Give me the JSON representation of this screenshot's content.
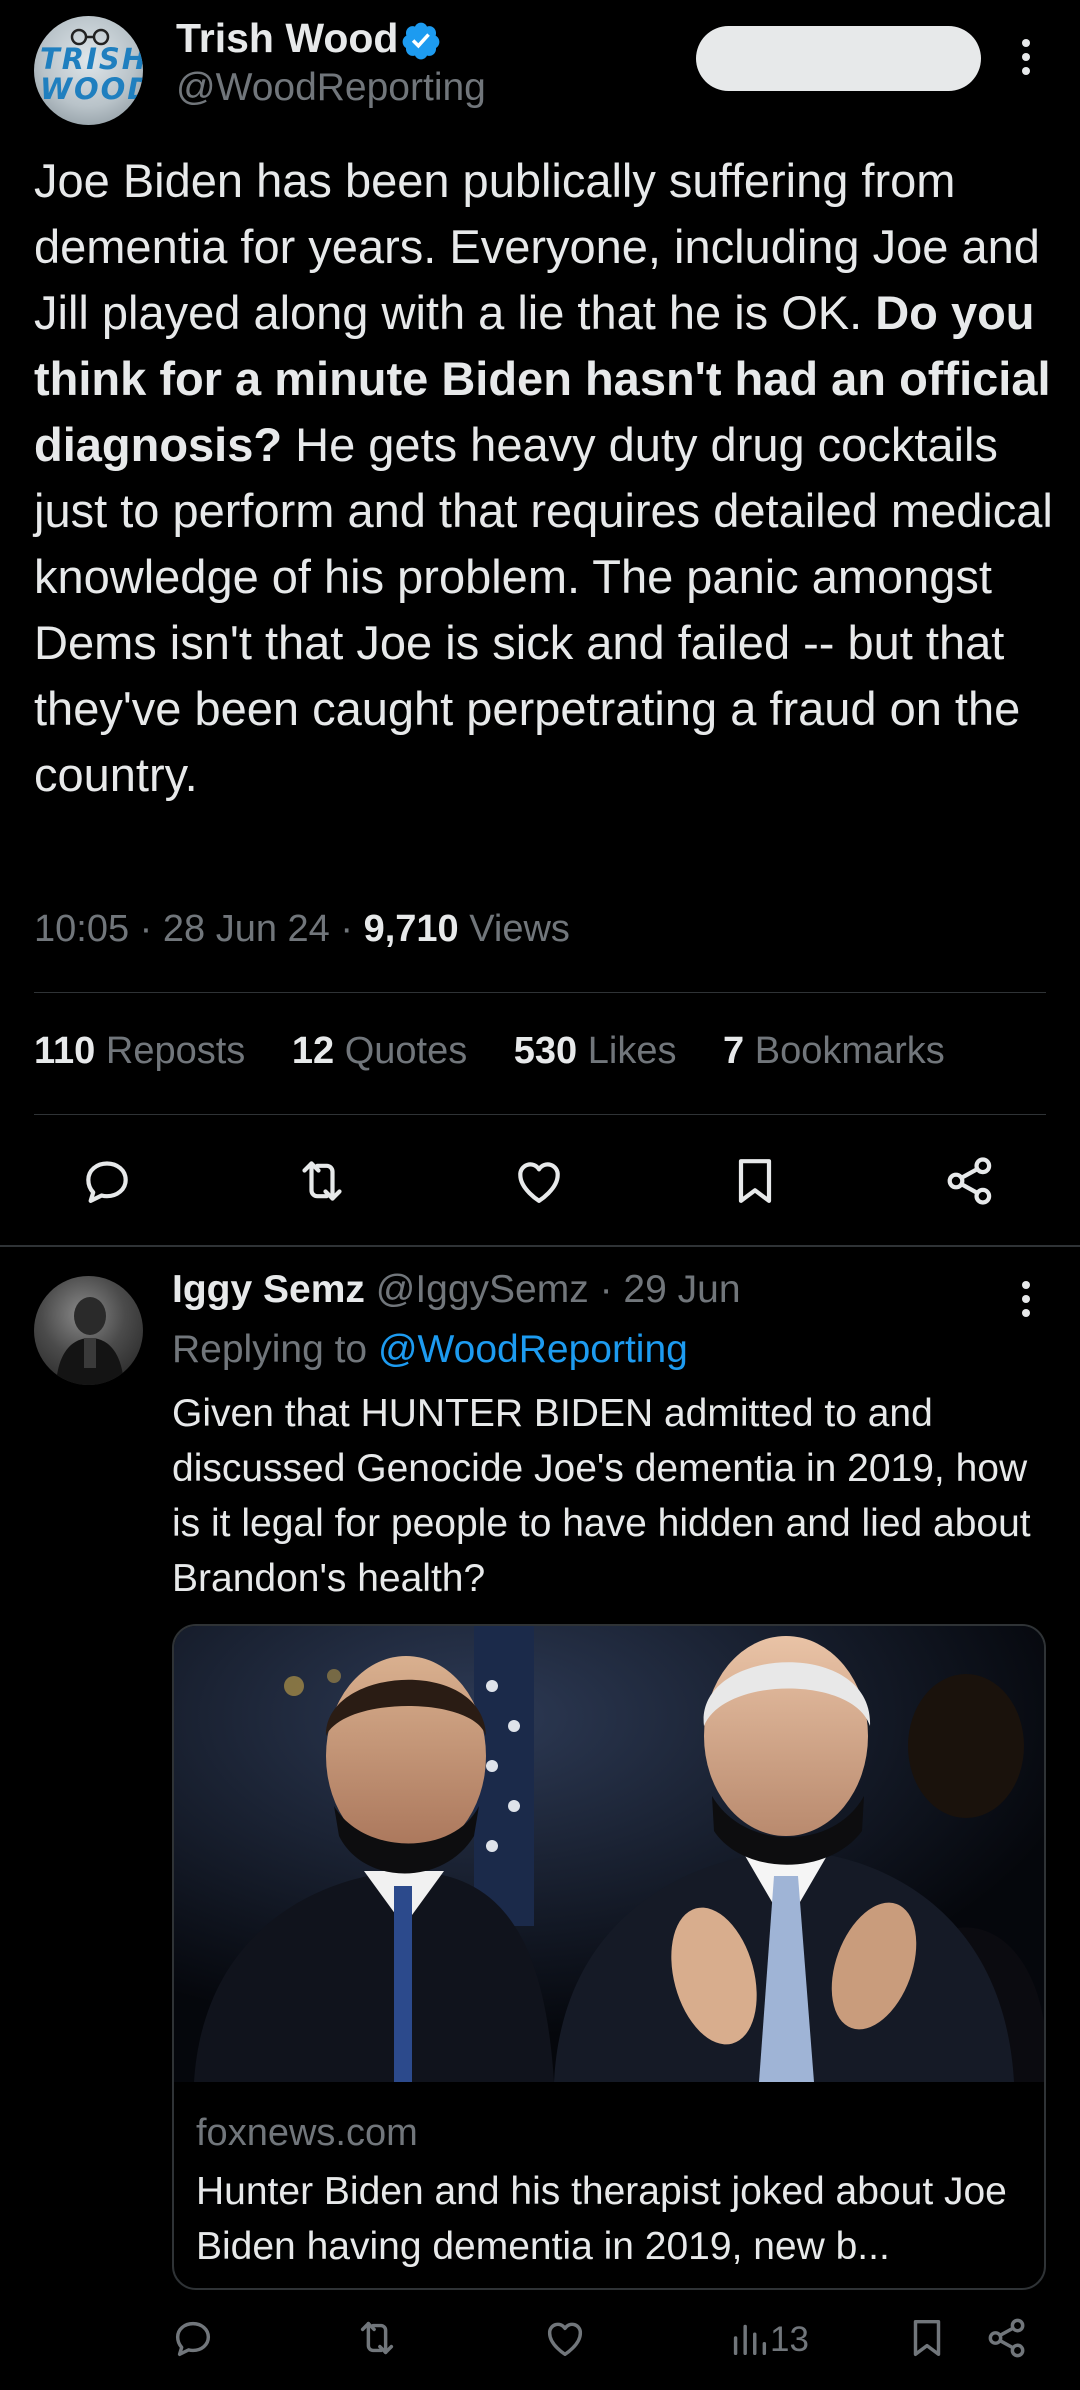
{
  "tweet": {
    "author": {
      "name": "Trish Wood",
      "handle": "@WoodReporting",
      "verified": true,
      "avatar_text_line1": "TRISH",
      "avatar_text_line2": "WOOD",
      "badge_color": "#1d9bf0"
    },
    "text": {
      "part1": "Joe Biden has been publically suffering from dementia for  years. Everyone, including Joe and Jill played along with a lie that he is OK. ",
      "bold": "Do you think for a minute Biden hasn't had an official diagnosis?",
      "part2": " He gets heavy duty drug cocktails just to perform and that requires detailed medical knowledge of his problem. The panic amongst Dems isn't that Joe is sick and failed -- but that they've been caught perpetrating a fraud on the country."
    },
    "meta": {
      "time": "10:05",
      "sep": "·",
      "date": "28 Jun 24",
      "views_count": "9,710",
      "views_label": "Views"
    },
    "stats": [
      {
        "count": "110",
        "label": "Reposts"
      },
      {
        "count": "12",
        "label": "Quotes"
      },
      {
        "count": "530",
        "label": "Likes"
      },
      {
        "count": "7",
        "label": "Bookmarks"
      }
    ],
    "actions": [
      "reply-icon",
      "repost-icon",
      "like-icon",
      "bookmark-icon",
      "share-icon"
    ]
  },
  "reply": {
    "author": {
      "name": "Iggy Semz",
      "handle": "@IggySemz",
      "sep": "·",
      "date": "29 Jun"
    },
    "replying_to_label": "Replying to",
    "replying_to_handle": "@WoodReporting",
    "text": "Given that HUNTER BIDEN admitted to and discussed Genocide Joe's dementia in 2019, how is it legal for people to have hidden and lied about Brandon's health?",
    "card": {
      "domain": "foxnews.com",
      "title": "Hunter Biden and his therapist joked about Joe Biden having dementia in 2019, new b..."
    },
    "views": "13",
    "actions": [
      "reply-icon",
      "repost-icon",
      "like-icon",
      "views-icon",
      "bookmark-icon",
      "share-icon"
    ]
  },
  "colors": {
    "background": "#000000",
    "text": "#e7e9ea",
    "secondary": "#71767b",
    "link": "#1d9bf0",
    "divider": "#2f3336"
  }
}
